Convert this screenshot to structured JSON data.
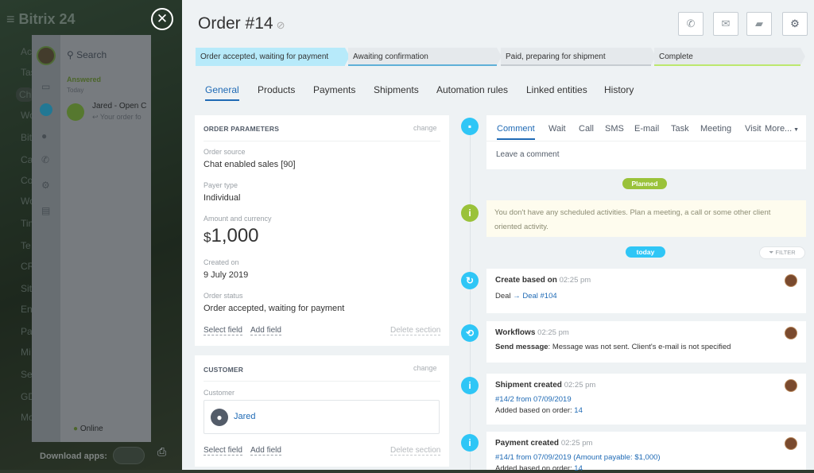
{
  "background": {
    "logo": "Bitrix 24",
    "nav_items": [
      "Ac",
      "Tas",
      "Ch",
      "Wo",
      "Bit",
      "Ca",
      "Co",
      "Wo",
      "Tim",
      "Te",
      "CR",
      "Sit",
      "En",
      "Pa",
      "Mi",
      "Se",
      "GD",
      "Mo"
    ],
    "download_apps": "Download apps:",
    "chat": {
      "search_placeholder": "Search",
      "answered": "Answered",
      "today": "Today",
      "item_name": "Jared - Open C",
      "item_preview": "Your order fo",
      "status": "Online"
    }
  },
  "header": {
    "title": "Order #14",
    "buttons": [
      "phone",
      "mail",
      "chat",
      "settings"
    ]
  },
  "stages": [
    {
      "label": "Order accepted, waiting for payment"
    },
    {
      "label": "Awaiting confirmation"
    },
    {
      "label": "Paid, preparing for shipment"
    },
    {
      "label": "Complete"
    }
  ],
  "tabs": [
    "General",
    "Products",
    "Payments",
    "Shipments",
    "Automation rules",
    "Linked entities",
    "History"
  ],
  "order_parameters": {
    "title": "ORDER PARAMETERS",
    "change": "change",
    "fields": [
      {
        "label": "Order source",
        "value": "Chat enabled sales [90]"
      },
      {
        "label": "Payer type",
        "value": "Individual"
      },
      {
        "label": "Amount and currency",
        "currency": "$",
        "value": "1,000"
      },
      {
        "label": "Created on",
        "value": "9 July 2019"
      },
      {
        "label": "Order status",
        "value": "Order accepted, waiting for payment"
      }
    ],
    "select_field": "Select field",
    "add_field": "Add field",
    "delete_section": "Delete section"
  },
  "customer": {
    "title": "CUSTOMER",
    "change": "change",
    "label": "Customer",
    "name": "Jared",
    "select_field": "Select field",
    "add_field": "Add field",
    "delete_section": "Delete section"
  },
  "activity": {
    "tabs": [
      "Comment",
      "Wait",
      "Call",
      "SMS",
      "E-mail",
      "Task",
      "Meeting",
      "Visit",
      "More..."
    ],
    "placeholder": "Leave a comment"
  },
  "timeline": {
    "planned_label": "Planned",
    "planned_text": "You don't have any scheduled activities. Plan a meeting, a call or some other client oriented activity.",
    "today_label": "today",
    "filter_label": "FILTER",
    "events": [
      {
        "title": "Create based on",
        "time": "02:25 pm",
        "line1_prefix": "Deal",
        "line1_arrow": "→",
        "line1_link": "Deal #104"
      },
      {
        "title": "Workflows",
        "time": "02:25 pm",
        "line1_bold": "Send message",
        "line1_text": ": Message was not sent. Client's e-mail is not specified"
      },
      {
        "title": "Shipment created",
        "time": "02:25 pm",
        "line1_link": "#14/2 from 07/09/2019",
        "line2_text": "Added based on order:",
        "line2_link": "14"
      },
      {
        "title": "Payment created",
        "time": "02:25 pm",
        "line1_link": "#14/1 from 07/09/2019 (Amount payable: $1,000)",
        "line2_text": "Added based on order:",
        "line2_link": "14"
      }
    ]
  },
  "colors": {
    "accent": "#1f6ab5",
    "stage_active": "#b7eafa",
    "timeline_blue": "#2fc6f6",
    "planned_green": "#9ac23a"
  }
}
